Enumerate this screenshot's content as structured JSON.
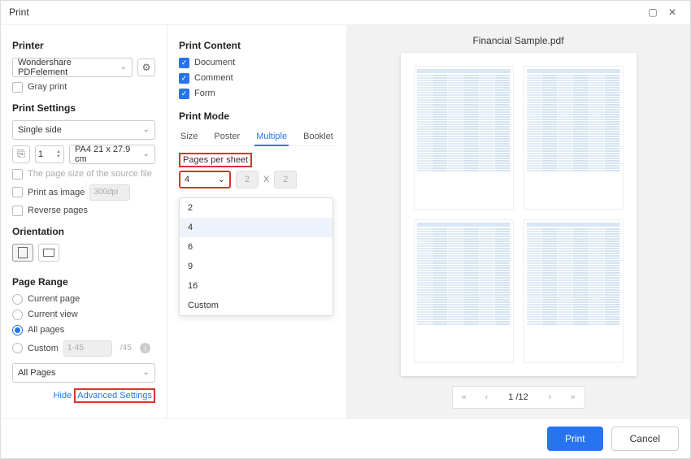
{
  "window": {
    "title": "Print"
  },
  "printer": {
    "title": "Printer",
    "selected": "Wondershare PDFelement",
    "gray_print": "Gray print"
  },
  "print_settings": {
    "title": "Print Settings",
    "sides": "Single side",
    "copies": "1",
    "paper_size": "PA4 21 x 27.9 cm",
    "source_file_size": "The page size of the source file",
    "print_as_image": "Print as image",
    "dpi": "300dpi",
    "reverse_pages": "Reverse pages"
  },
  "orientation": {
    "title": "Orientation"
  },
  "page_range": {
    "title": "Page Range",
    "current_page": "Current page",
    "current_view": "Current view",
    "all_pages": "All pages",
    "custom": "Custom",
    "custom_placeholder": "1-45",
    "total_suffix": "/45",
    "subset": "All Pages"
  },
  "advanced": {
    "hide": "Hide",
    "label": "Advanced Settings"
  },
  "print_content": {
    "title": "Print Content",
    "document": "Document",
    "comment": "Comment",
    "form": "Form"
  },
  "print_mode": {
    "title": "Print Mode",
    "tabs": {
      "size": "Size",
      "poster": "Poster",
      "multiple": "Multiple",
      "booklet": "Booklet"
    },
    "pages_per_sheet_label": "Pages per sheet",
    "pages_per_sheet_value": "4",
    "dim1": "2",
    "x": "X",
    "dim2": "2",
    "options": [
      "2",
      "4",
      "6",
      "9",
      "16",
      "Custom"
    ]
  },
  "preview": {
    "filename": "Financial Sample.pdf",
    "page_indicator": "1 /12"
  },
  "footer": {
    "print": "Print",
    "cancel": "Cancel"
  }
}
